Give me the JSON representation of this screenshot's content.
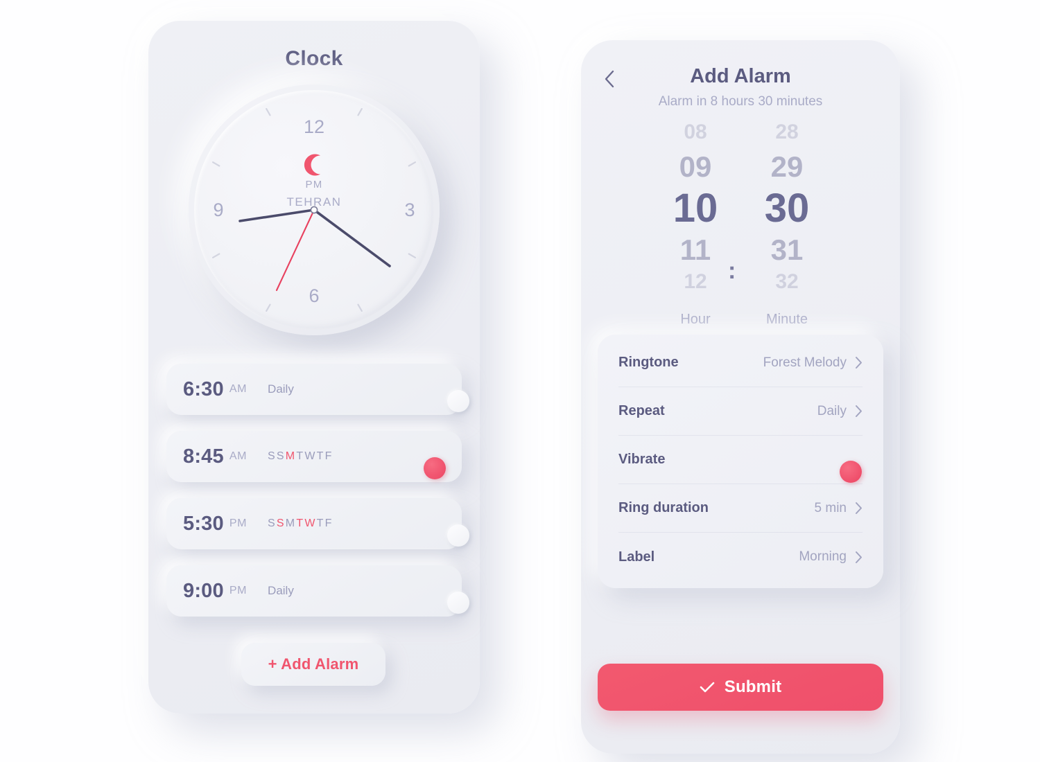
{
  "theme": {
    "accent": "#f0556e",
    "text_dark": "#5b5b80",
    "text_muted": "#a9abc7",
    "surface": "#eceef4"
  },
  "clock_screen": {
    "title": "Clock",
    "dial": {
      "numerals": [
        "12",
        "3",
        "6",
        "9"
      ],
      "moon_icon": "crescent-moon-icon",
      "meridiem": "PM",
      "timezone": "TEHRAN",
      "hour_hand_deg": 262,
      "minute_hand_deg": 130,
      "second_hand_deg": 200
    },
    "alarms": [
      {
        "time": "6:30",
        "meridiem": "AM",
        "repeat_text": "Daily",
        "days": null,
        "enabled": false
      },
      {
        "time": "8:45",
        "meridiem": "AM",
        "repeat_text": null,
        "days": [
          {
            "letter": "S",
            "on": false
          },
          {
            "letter": "S",
            "on": false
          },
          {
            "letter": "M",
            "on": true
          },
          {
            "letter": "T",
            "on": false
          },
          {
            "letter": "W",
            "on": false
          },
          {
            "letter": "T",
            "on": false
          },
          {
            "letter": "F",
            "on": false
          }
        ],
        "enabled": true
      },
      {
        "time": "5:30",
        "meridiem": "PM",
        "repeat_text": null,
        "days": [
          {
            "letter": "S",
            "on": false
          },
          {
            "letter": "S",
            "on": true
          },
          {
            "letter": "M",
            "on": false
          },
          {
            "letter": "T",
            "on": true
          },
          {
            "letter": "W",
            "on": true
          },
          {
            "letter": "T",
            "on": false
          },
          {
            "letter": "F",
            "on": false
          }
        ],
        "enabled": false
      },
      {
        "time": "9:00",
        "meridiem": "PM",
        "repeat_text": "Daily",
        "days": null,
        "enabled": false
      }
    ],
    "add_alarm_label": "+ Add Alarm"
  },
  "add_alarm_screen": {
    "back_icon": "chevron-left-icon",
    "title": "Add Alarm",
    "subtitle": "Alarm in 8 hours 30 minutes",
    "picker": {
      "separator": ":",
      "hour": {
        "label": "Hour",
        "far_above": "08",
        "near_above": "09",
        "selected": "10",
        "near_below": "11",
        "far_below": "12"
      },
      "minute": {
        "label": "Minute",
        "far_above": "28",
        "near_above": "29",
        "selected": "30",
        "near_below": "31",
        "far_below": "32"
      }
    },
    "settings": [
      {
        "label": "Ringtone",
        "value": "Forest Melody",
        "type": "link"
      },
      {
        "label": "Repeat",
        "value": "Daily",
        "type": "link"
      },
      {
        "label": "Vibrate",
        "value": null,
        "type": "toggle",
        "enabled": true
      },
      {
        "label": "Ring duration",
        "value": "5 min",
        "type": "link"
      },
      {
        "label": "Label",
        "value": "Morning",
        "type": "link"
      }
    ],
    "submit_label": "Submit",
    "submit_icon": "check-icon"
  }
}
